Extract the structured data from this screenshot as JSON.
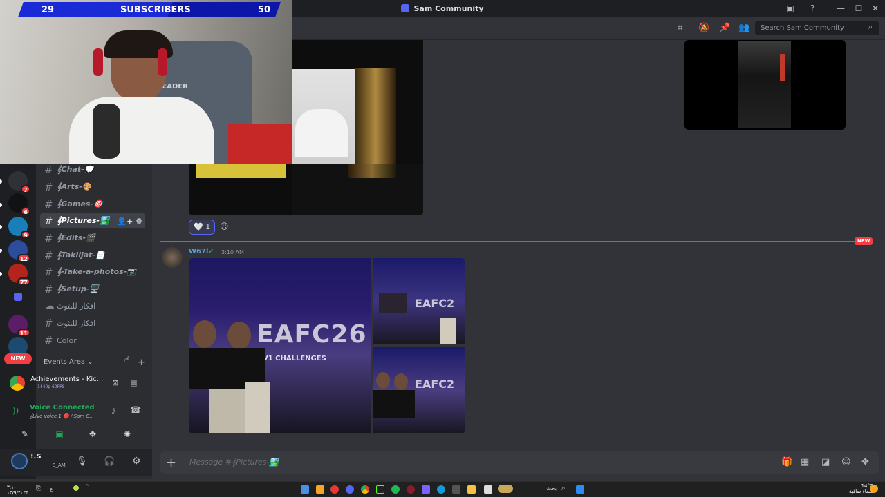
{
  "window": {
    "title": "Sam Community",
    "minimize": "—",
    "maximize": "☐",
    "close": "✕"
  },
  "servers": [
    {
      "name": "server-1",
      "badge": "7",
      "color": "#2f3136"
    },
    {
      "name": "server-2",
      "badge": "6",
      "color": "#111214"
    },
    {
      "name": "server-3",
      "badge": "9",
      "color": "#1a7fb8"
    },
    {
      "name": "server-4",
      "badge": "12",
      "color": "#2b4d9c"
    },
    {
      "name": "server-5",
      "badge": "77",
      "color": "#b3241c"
    },
    {
      "name": "folder",
      "badge": "",
      "color": "#5865f2"
    },
    {
      "name": "server-6",
      "badge": "11",
      "color": "#5a1d66"
    },
    {
      "name": "server-7",
      "badge": "",
      "color": "#1d4b70"
    }
  ],
  "rail_new": "NEW",
  "channels": [
    {
      "label": "𝄞Chat-💭",
      "active": false
    },
    {
      "label": "𝄞Arts-🎨",
      "active": false
    },
    {
      "label": "𝄞Games-🎯",
      "active": false
    },
    {
      "label": "𝄞Pictures-🏞️",
      "active": true
    },
    {
      "label": "𝄞Edits-🎬",
      "active": false
    },
    {
      "label": "𝄞Taklijat-📄",
      "active": false
    },
    {
      "label": "𝄞-Take-a-photos-📷",
      "active": false
    },
    {
      "label": "𝄞Setup-🖥️",
      "active": false
    },
    {
      "label": "افكار للبثوث",
      "active": false
    },
    {
      "label": "افكار للبثوث",
      "active": false
    },
    {
      "label": "Color",
      "active": false
    }
  ],
  "events_category": "Events Area ⌄",
  "activity": {
    "title": "Achievements - Kic...",
    "subtitle": "1440p 60FPS"
  },
  "voice": {
    "status": "Voice Connected",
    "channel": "𝄞Live voice 1 🔴 / Sam C..."
  },
  "user": {
    "name": "!.S",
    "tag": "S_AM"
  },
  "header": {
    "search_placeholder": "Search Sam Community"
  },
  "messages": [
    {
      "author": "W67l",
      "time": "3:10 AM",
      "author_color": "#5ca0d3"
    }
  ],
  "reaction": {
    "emoji": "🤍",
    "count": "1"
  },
  "new_label": "NEW",
  "composer": {
    "placeholder": "Message #𝄞Pictures-🏞️"
  },
  "gallery_texts": {
    "big": "EAFC26",
    "sub": "1V1 CHALLENGES",
    "small": "EAFC2"
  },
  "overlay": {
    "subs_current": "29",
    "subs_label": "SUBSCRIBERS",
    "subs_goal": "50",
    "chair_brand": "LEADER"
  },
  "taskbar": {
    "clock_time": "٣:١٠",
    "clock_date": "١٢/٩/٢٠٢٥",
    "search": "بحث",
    "lang": "ع",
    "weather": "14°C",
    "weather_sub": "سماء صافية"
  },
  "colors": {
    "accent": "#5865f2",
    "danger": "#f23f43",
    "voice_green": "#23a55a"
  }
}
